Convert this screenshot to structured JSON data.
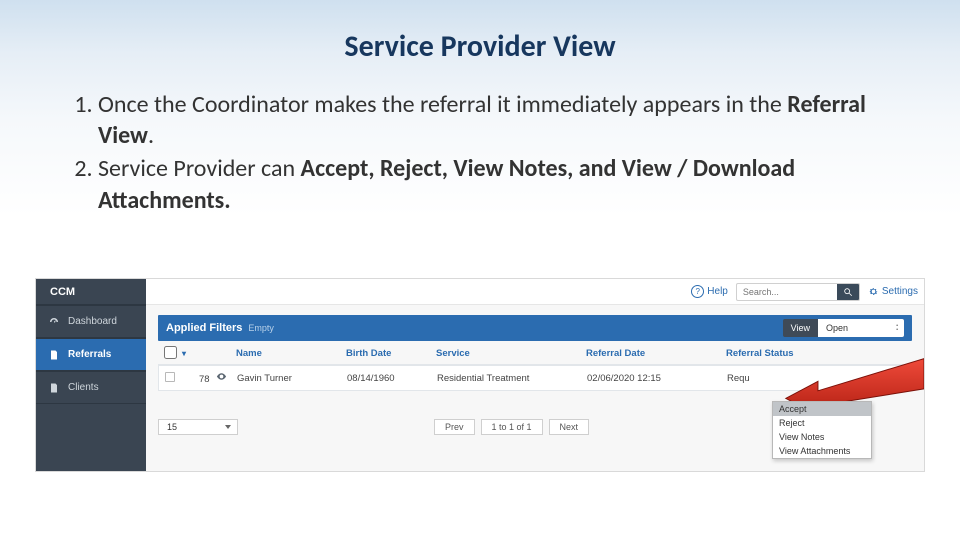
{
  "title": "Service Provider View",
  "list": {
    "item1_a": "Once the Coordinator makes the referral it immediately appears in the ",
    "item1_b": "Referral View",
    "item1_c": ".",
    "item2_a": "Service Provider can ",
    "item2_b": "Accept, Reject, View Notes, and View / Download Attachments.",
    "item2_c": ""
  },
  "brand": "CCM",
  "topbar": {
    "help": "Help",
    "search_placeholder": "Search...",
    "settings": "Settings"
  },
  "nav": {
    "dashboard": "Dashboard",
    "referrals": "Referrals",
    "clients": "Clients"
  },
  "filters": {
    "title": "Applied Filters",
    "empty": "Empty",
    "view_label": "View",
    "view_value": "Open"
  },
  "headers": {
    "name": "Name",
    "birth_date": "Birth Date",
    "service": "Service",
    "referral_date": "Referral Date",
    "referral_status": "Referral Status"
  },
  "row": {
    "id": "78",
    "name": "Gavin Turner",
    "birth_date": "08/14/1960",
    "service": "Residential Treatment",
    "referral_date": "02/06/2020 12:15",
    "referral_status": "Requ"
  },
  "pager": {
    "size": "15",
    "prev": "Prev",
    "range": "1 to 1 of 1",
    "next": "Next"
  },
  "dropdown": {
    "accept": "Accept",
    "reject": "Reject",
    "notes": "View Notes",
    "attachments": "View Attachments"
  }
}
